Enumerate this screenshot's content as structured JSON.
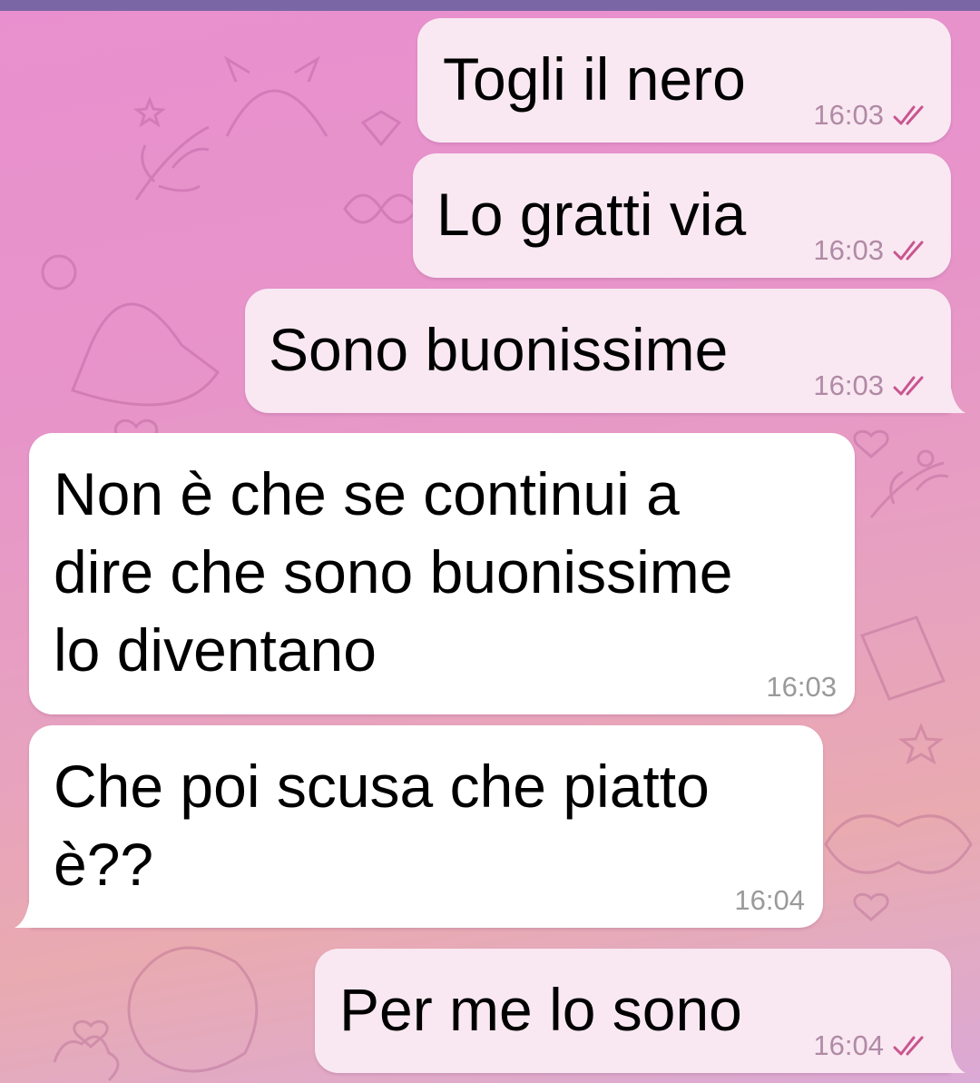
{
  "theme": {
    "outgoing_bubble": "#f9e8f2",
    "incoming_bubble": "#ffffff",
    "check_color": "#c9558f",
    "top_bar": "#7a66a4"
  },
  "messages": [
    {
      "direction": "outgoing",
      "text": "Togli il nero",
      "time": "16:03",
      "status": "read"
    },
    {
      "direction": "outgoing",
      "text": "Lo gratti via",
      "time": "16:03",
      "status": "read"
    },
    {
      "direction": "outgoing",
      "text": "Sono buonissime",
      "time": "16:03",
      "status": "read"
    },
    {
      "direction": "incoming",
      "text": "Non è che se continui a\ndire che sono buonissime\nlo diventano",
      "time": "16:03"
    },
    {
      "direction": "incoming",
      "text": "Che poi scusa che piatto\nè??",
      "time": "16:04"
    },
    {
      "direction": "outgoing",
      "text": "Per me lo sono",
      "time": "16:04",
      "status": "read"
    }
  ]
}
